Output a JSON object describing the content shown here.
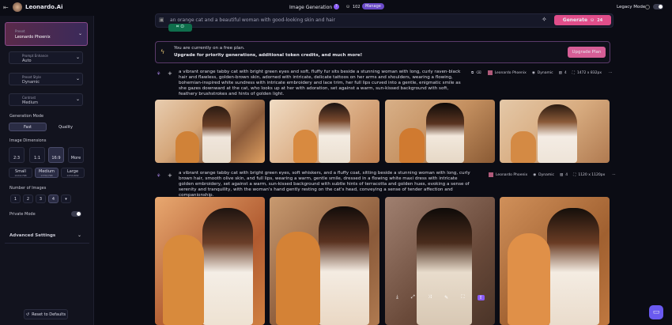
{
  "app": {
    "brand": "Leonardo.Ai",
    "nav_title": "Image Generation",
    "tokens": "102",
    "manage": "Manage",
    "legacy_mode": "Legacy Mode"
  },
  "prompt_bar": {
    "value": "an orange cat and a beautiful woman with good-looking skin and hair",
    "generate": "Generate",
    "cost": "24"
  },
  "banner": {
    "line1": "You are currently on a free plan.",
    "line2": "Upgrade for priority generations, additional token credits, and much more!",
    "cta": "Upgrade Plan"
  },
  "sidebar": {
    "preset_label": "Preset",
    "preset_value": "Leonardo Phoenix",
    "prompt_enhance_label": "Prompt Enhance",
    "prompt_enhance_value": "Auto",
    "preset_style_label": "Preset Style",
    "preset_style_value": "Dynamic",
    "contrast_label": "Contrast",
    "contrast_value": "Medium",
    "gen_mode": "Generation Mode",
    "fast": "Fast",
    "quality": "Quality",
    "dims": "Image Dimensions",
    "ratios": [
      "2:3",
      "1:1",
      "16:9",
      "More"
    ],
    "sizes": [
      {
        "l": "Small",
        "s": "1024x768"
      },
      {
        "l": "Medium",
        "s": "1376x768"
      },
      {
        "l": "Large",
        "s": "1472x832"
      }
    ],
    "num_images": "Number of Images",
    "counts": [
      "1",
      "2",
      "3",
      "4"
    ],
    "private": "Private Mode",
    "advanced": "Advanced Settings",
    "reset": "Reset to Defaults"
  },
  "gen1": {
    "prompt": "a vibrant orange tabby cat with bright green eyes and soft, fluffy fur sits beside a stunning woman with long, curly raven-black hair and flawless, golden-brown skin, adorned with intricate, delicate tattoos on her arms and shoulders, wearing a flowing, bohemian-inspired white sundress with intricate embroidery and lace trim, her full lips curved into a gentle, enigmatic smile as she gazes downward at the cat, who looks up at her with adoration, set against a warm, sun-kissed background with soft, feathery brushstrokes and hints of golden light.",
    "model": "Leonardo Phoenix",
    "style": "Dynamic",
    "count": "4",
    "dims": "1472 x 832px"
  },
  "gen2": {
    "prompt": "a vibrant orange tabby cat with bright green eyes, soft whiskers, and a fluffy coat, sitting beside a stunning woman with long, curly brown hair, smooth olive skin, and full lips, wearing a warm, gentle smile, dressed in a flowing white maxi dress with intricate golden embroidery, set against a warm, sun-kissed background with subtle hints of terracotta and golden hues, evoking a sense of serenity and tranquility, with the woman's hand gently resting on the cat's head, conveying a sense of tender affection and companionship.",
    "model": "Leonardo Phoenix",
    "style": "Dynamic",
    "count": "4",
    "dims": "1120 x 1120px"
  },
  "colors": {
    "accent": "#e04e8a",
    "purple": "#8a5cf6",
    "bg": "#0b0c14"
  }
}
